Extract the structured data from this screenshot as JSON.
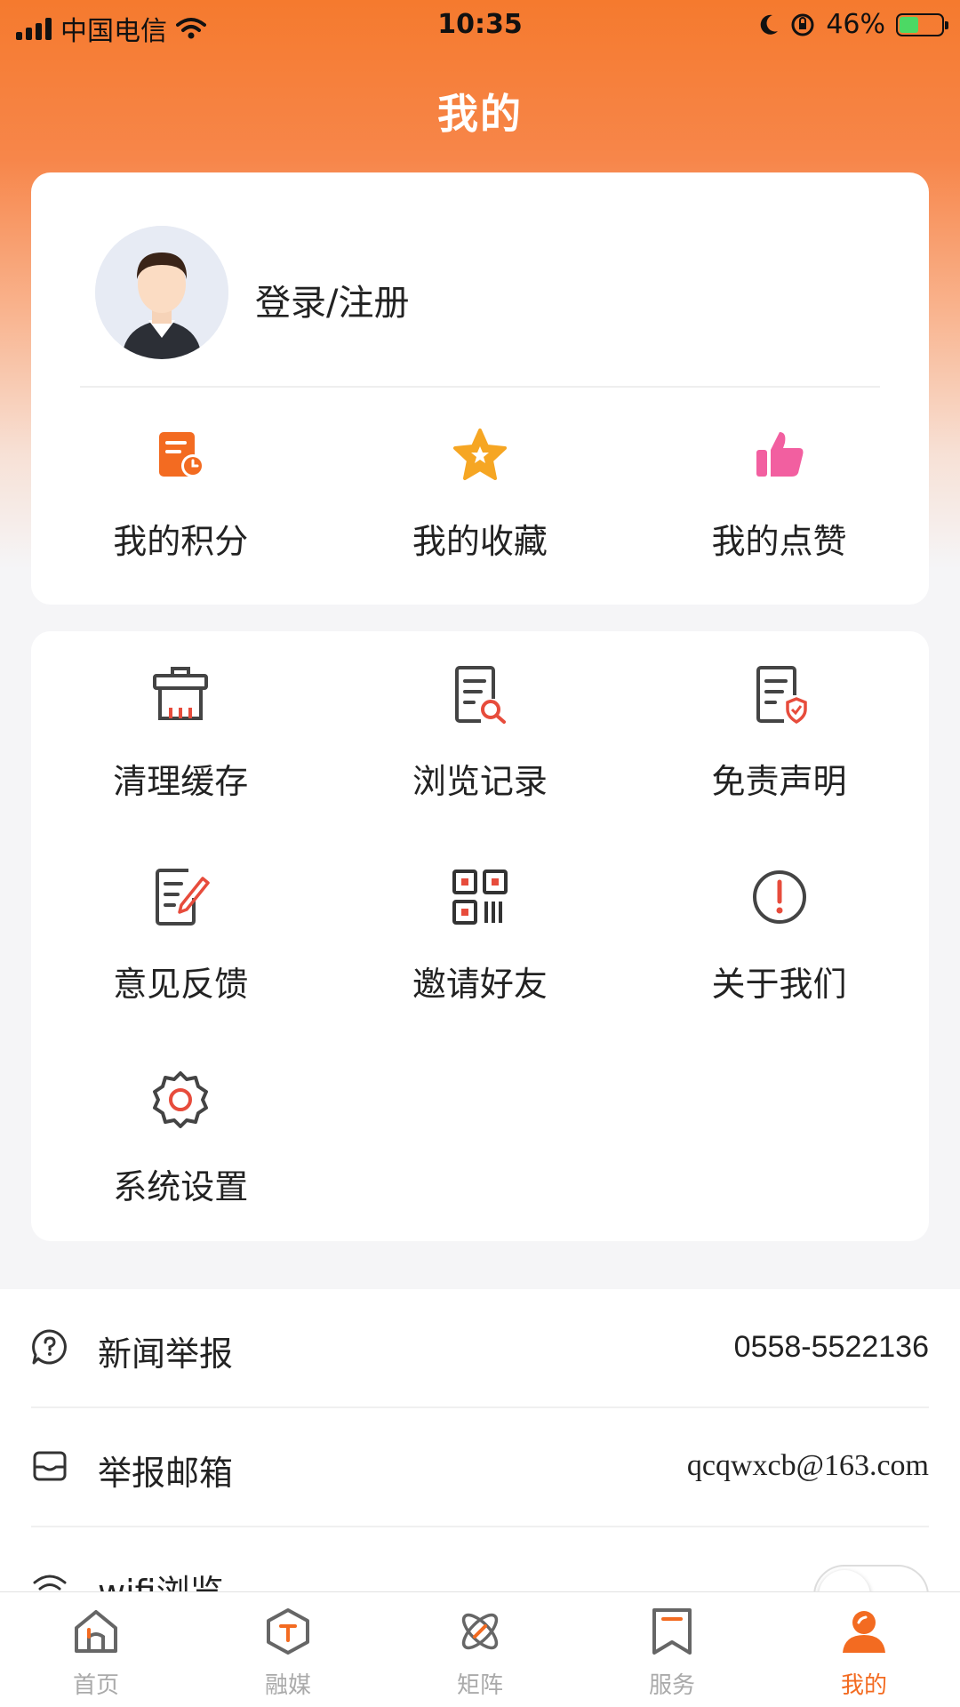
{
  "status_bar": {
    "carrier": "中国电信",
    "time": "10:35",
    "battery": "46%"
  },
  "header": {
    "title": "我的"
  },
  "profile": {
    "login_label": "登录/注册"
  },
  "quick_actions": [
    {
      "label": "我的积分",
      "icon": "points-icon"
    },
    {
      "label": "我的收藏",
      "icon": "star-icon"
    },
    {
      "label": "我的点赞",
      "icon": "thumbs-up-icon"
    }
  ],
  "services": [
    {
      "label": "清理缓存",
      "icon": "clear-cache-icon"
    },
    {
      "label": "浏览记录",
      "icon": "history-icon"
    },
    {
      "label": "免责声明",
      "icon": "disclaimer-icon"
    },
    {
      "label": "意见反馈",
      "icon": "feedback-icon"
    },
    {
      "label": "邀请好友",
      "icon": "qr-code-icon"
    },
    {
      "label": "关于我们",
      "icon": "info-icon"
    },
    {
      "label": "系统设置",
      "icon": "settings-icon"
    }
  ],
  "list": {
    "report": {
      "label": "新闻举报",
      "value": "0558-5522136"
    },
    "email": {
      "label": "举报邮箱",
      "value": "qcqwxcb@163.com"
    },
    "wifi": {
      "label": "wifi浏览",
      "enabled": false
    }
  },
  "tabs": [
    {
      "label": "首页",
      "icon": "home-icon"
    },
    {
      "label": "融媒",
      "icon": "media-icon"
    },
    {
      "label": "矩阵",
      "icon": "matrix-icon"
    },
    {
      "label": "服务",
      "icon": "service-icon"
    },
    {
      "label": "我的",
      "icon": "profile-icon",
      "active": true
    }
  ],
  "colors": {
    "accent": "#f36b21",
    "header_gradient_top": "#f57a2e"
  }
}
